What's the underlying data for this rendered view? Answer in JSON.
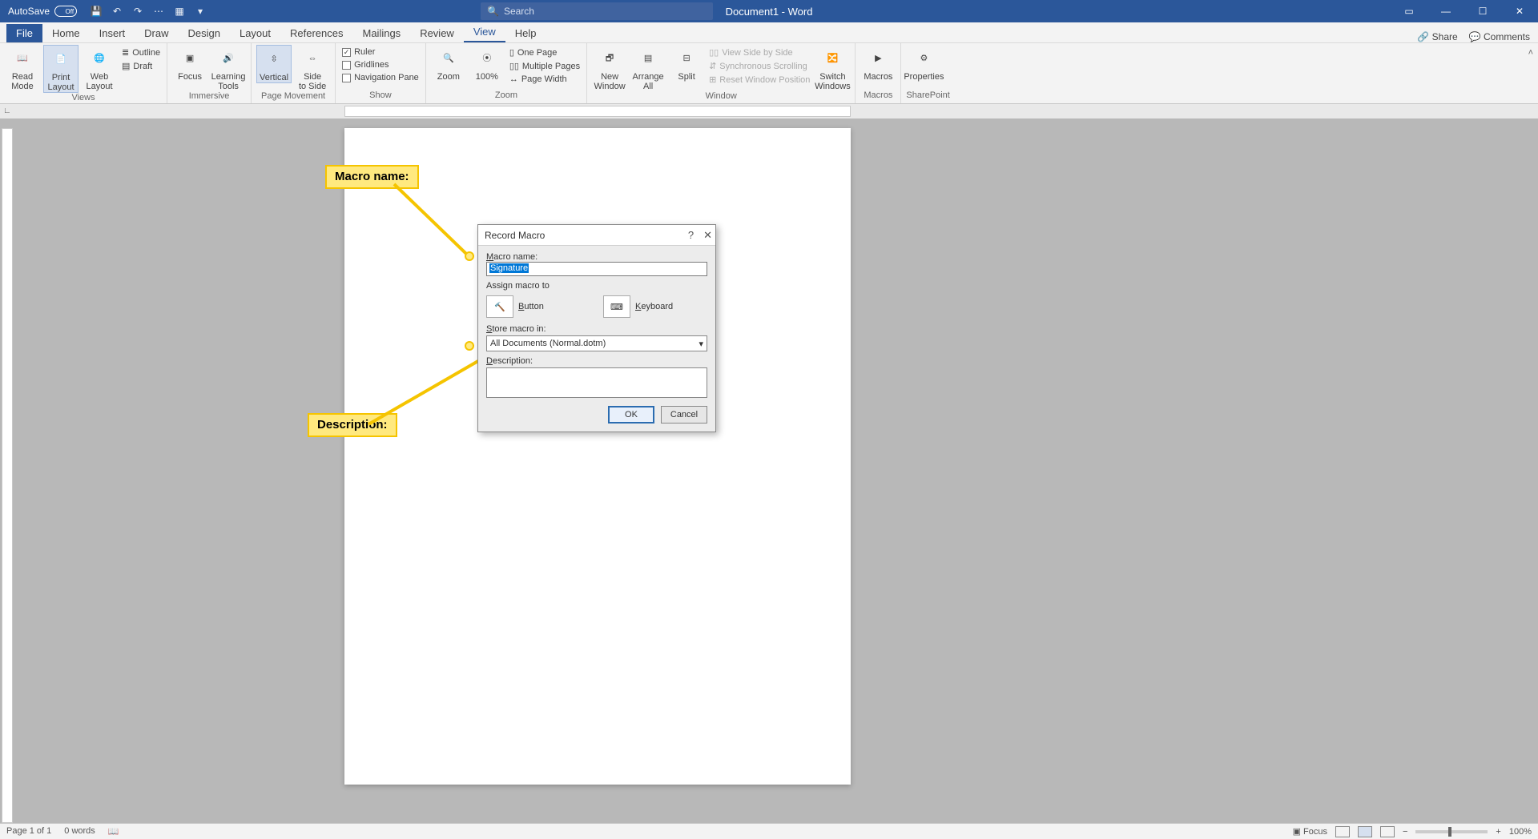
{
  "titlebar": {
    "autosave": "AutoSave",
    "autosave_state": "Off",
    "doc_title": "Document1 - Word",
    "search_placeholder": "Search"
  },
  "tabs": {
    "file": "File",
    "home": "Home",
    "insert": "Insert",
    "draw": "Draw",
    "design": "Design",
    "layout": "Layout",
    "references": "References",
    "mailings": "Mailings",
    "review": "Review",
    "view": "View",
    "help": "Help",
    "share": "Share",
    "comments": "Comments"
  },
  "ribbon": {
    "views": {
      "read_mode": "Read\nMode",
      "print_layout": "Print\nLayout",
      "web_layout": "Web\nLayout",
      "outline": "Outline",
      "draft": "Draft",
      "label": "Views"
    },
    "immersive": {
      "focus": "Focus",
      "learning_tools": "Learning\nTools",
      "label": "Immersive"
    },
    "page_movement": {
      "vertical": "Vertical",
      "side": "Side\nto Side",
      "label": "Page Movement"
    },
    "show": {
      "ruler": "Ruler",
      "gridlines": "Gridlines",
      "nav": "Navigation Pane",
      "label": "Show"
    },
    "zoom": {
      "zoom": "Zoom",
      "hundred": "100%",
      "one_page": "One Page",
      "multi": "Multiple Pages",
      "width": "Page Width",
      "label": "Zoom"
    },
    "window": {
      "new": "New\nWindow",
      "arrange": "Arrange\nAll",
      "split": "Split",
      "side_by_side": "View Side by Side",
      "sync": "Synchronous Scrolling",
      "reset": "Reset Window Position",
      "switch": "Switch\nWindows",
      "label": "Window"
    },
    "macros": {
      "macros": "Macros",
      "label": "Macros"
    },
    "sharepoint": {
      "properties": "Properties",
      "label": "SharePoint"
    }
  },
  "dialog": {
    "title": "Record Macro",
    "macro_name_label": "Macro name:",
    "macro_name_value": "Signature",
    "assign_label": "Assign macro to",
    "button": "Button",
    "keyboard": "Keyboard",
    "store_label": "Store macro in:",
    "store_value": "All Documents (Normal.dotm)",
    "description_label": "Description:",
    "ok": "OK",
    "cancel": "Cancel"
  },
  "callouts": {
    "macro_name": "Macro name:",
    "description": "Description:"
  },
  "statusbar": {
    "page": "Page 1 of 1",
    "words": "0 words",
    "focus": "Focus",
    "zoom": "100%"
  }
}
